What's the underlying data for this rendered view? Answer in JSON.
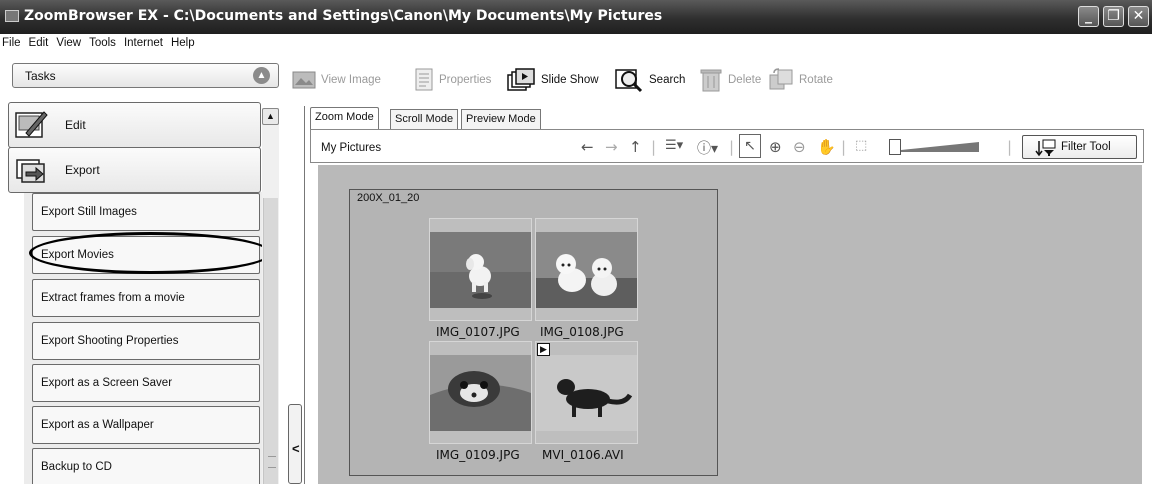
{
  "window": {
    "title": "ZoomBrowser EX  -  C:\\Documents and Settings\\Canon\\My Documents\\My Pictures",
    "controls": [
      "_",
      "❐",
      "✕"
    ]
  },
  "menu": [
    "File",
    "Edit",
    "View",
    "Tools",
    "Internet",
    "Help"
  ],
  "tasks_panel": {
    "header": "Tasks",
    "categories": [
      {
        "label": "Edit",
        "icon": "edit-icon"
      },
      {
        "label": "Export",
        "icon": "export-icon"
      }
    ],
    "items": [
      "Export Still Images",
      "Export Movies",
      "Extract frames from a movie",
      "Export Shooting Properties",
      "Export as a Screen Saver",
      "Export as a Wallpaper",
      "Backup to CD"
    ],
    "highlighted_item": "Export Movies",
    "collapse_glyph": "<"
  },
  "toolbar": {
    "view_image": "View Image",
    "properties": "Properties",
    "slide_show": "Slide Show",
    "search": "Search",
    "delete": "Delete",
    "rotate": "Rotate"
  },
  "tabs": [
    "Zoom Mode",
    "Scroll Mode",
    "Preview Mode"
  ],
  "active_tab": "Zoom Mode",
  "location": "My Pictures",
  "filter_tool": "Filter Tool",
  "folder": {
    "name": "200X_01_20",
    "files": [
      {
        "name": "IMG_0107.JPG",
        "type": "photo"
      },
      {
        "name": "IMG_0108.JPG",
        "type": "photo"
      },
      {
        "name": "IMG_0109.JPG",
        "type": "photo"
      },
      {
        "name": "MVI_0106.AVI",
        "type": "movie"
      }
    ]
  },
  "colors": {
    "titlebar": "#2f2f2f",
    "browse_background": "#b9b9b9",
    "group_background": "#b4b4b4"
  }
}
